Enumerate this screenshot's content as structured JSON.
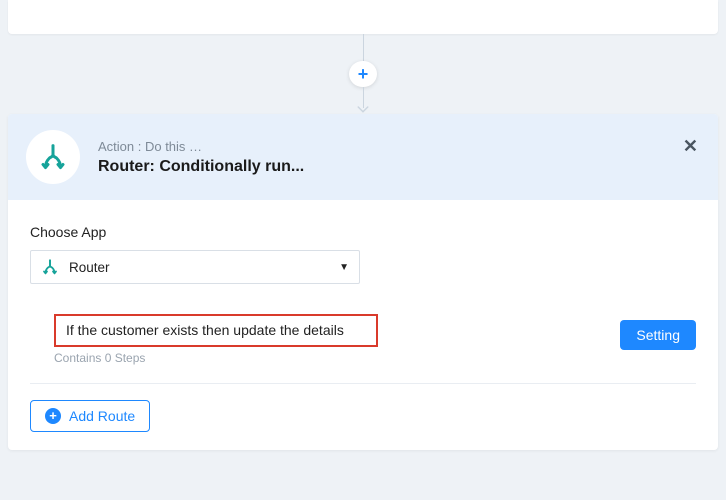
{
  "connector": {
    "add_label": "+"
  },
  "card": {
    "header": {
      "subtitle": "Action : Do this …",
      "title": "Router: Conditionally run..."
    },
    "choose_app_label": "Choose App",
    "app_select": {
      "value": "Router"
    },
    "routes": [
      {
        "name": "If the customer exists then update the details",
        "steps_text": "Contains 0 Steps",
        "setting_label": "Setting"
      }
    ],
    "add_route_label": "Add Route"
  }
}
